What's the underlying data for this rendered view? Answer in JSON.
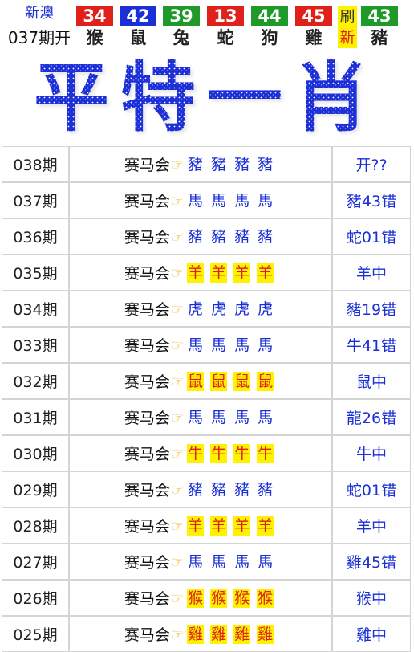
{
  "header": {
    "brand": "新澳",
    "period": "037期开",
    "balls": [
      {
        "number": "34",
        "zodiac": "猴",
        "color": "#e0211b"
      },
      {
        "number": "42",
        "zodiac": "鼠",
        "color": "#1a2fd6"
      },
      {
        "number": "39",
        "zodiac": "兔",
        "color": "#1f9a2a"
      },
      {
        "number": "13",
        "zodiac": "蛇",
        "color": "#e0211b"
      },
      {
        "number": "44",
        "zodiac": "狗",
        "color": "#1f9a2a"
      },
      {
        "number": "45",
        "zodiac": "雞",
        "color": "#e0211b"
      },
      {
        "number": "43",
        "zodiac": "豬",
        "color": "#1f9a2a"
      }
    ],
    "refresh_label": "刷",
    "refresh_new": "新"
  },
  "banner": {
    "text": "平特一肖",
    "color": "#1a2fd6"
  },
  "rows": [
    {
      "period": "038期",
      "label": "赛马会",
      "zodiac": [
        "豬",
        "豬",
        "豬",
        "豬"
      ],
      "highlight": false,
      "result": "开??"
    },
    {
      "period": "037期",
      "label": "赛马会",
      "zodiac": [
        "馬",
        "馬",
        "馬",
        "馬"
      ],
      "highlight": false,
      "result": "豬43错"
    },
    {
      "period": "036期",
      "label": "赛马会",
      "zodiac": [
        "豬",
        "豬",
        "豬",
        "豬"
      ],
      "highlight": false,
      "result": "蛇01错"
    },
    {
      "period": "035期",
      "label": "赛马会",
      "zodiac": [
        "羊",
        "羊",
        "羊",
        "羊"
      ],
      "highlight": true,
      "result": "羊中"
    },
    {
      "period": "034期",
      "label": "赛马会",
      "zodiac": [
        "虎",
        "虎",
        "虎",
        "虎"
      ],
      "highlight": false,
      "result": "豬19错"
    },
    {
      "period": "033期",
      "label": "赛马会",
      "zodiac": [
        "馬",
        "馬",
        "馬",
        "馬"
      ],
      "highlight": false,
      "result": "牛41错"
    },
    {
      "period": "032期",
      "label": "赛马会",
      "zodiac": [
        "鼠",
        "鼠",
        "鼠",
        "鼠"
      ],
      "highlight": true,
      "result": "鼠中"
    },
    {
      "period": "031期",
      "label": "赛马会",
      "zodiac": [
        "馬",
        "馬",
        "馬",
        "馬"
      ],
      "highlight": false,
      "result": "龍26错"
    },
    {
      "period": "030期",
      "label": "赛马会",
      "zodiac": [
        "牛",
        "牛",
        "牛",
        "牛"
      ],
      "highlight": true,
      "result": "牛中"
    },
    {
      "period": "029期",
      "label": "赛马会",
      "zodiac": [
        "豬",
        "豬",
        "豬",
        "豬"
      ],
      "highlight": false,
      "result": "蛇01错"
    },
    {
      "period": "028期",
      "label": "赛马会",
      "zodiac": [
        "羊",
        "羊",
        "羊",
        "羊"
      ],
      "highlight": true,
      "result": "羊中"
    },
    {
      "period": "027期",
      "label": "赛马会",
      "zodiac": [
        "馬",
        "馬",
        "馬",
        "馬"
      ],
      "highlight": false,
      "result": "雞45错"
    },
    {
      "period": "026期",
      "label": "赛马会",
      "zodiac": [
        "猴",
        "猴",
        "猴",
        "猴"
      ],
      "highlight": true,
      "result": "猴中"
    },
    {
      "period": "025期",
      "label": "赛马会",
      "zodiac": [
        "雞",
        "雞",
        "雞",
        "雞"
      ],
      "highlight": true,
      "result": "雞中"
    }
  ],
  "icons": {
    "pointer": "pointing-hand-icon"
  }
}
